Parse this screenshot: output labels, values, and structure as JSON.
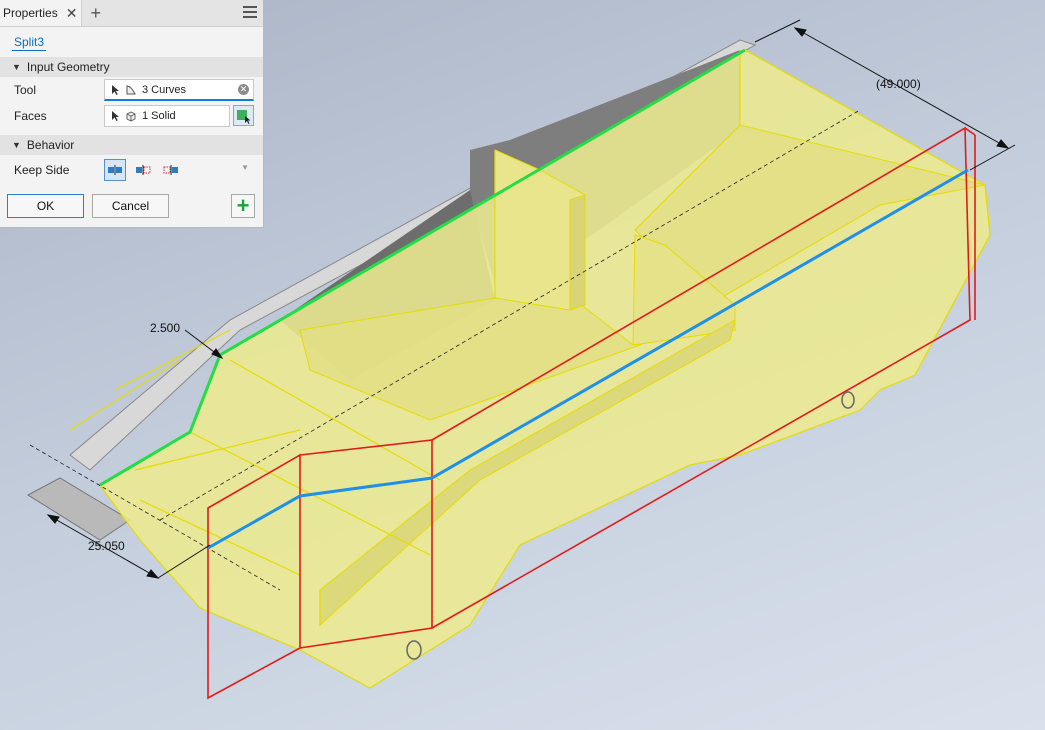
{
  "panel": {
    "tab_label": "Properties",
    "close_glyph": "✕",
    "add_glyph": "+",
    "feature_name": "Split3",
    "sections": {
      "input_geometry": "Input Geometry",
      "behavior": "Behavior"
    },
    "rows": {
      "tool_label": "Tool",
      "tool_value": "3 Curves",
      "faces_label": "Faces",
      "faces_value": "1 Solid",
      "keep_side_label": "Keep Side"
    },
    "keep_side_options": [
      "keep-both-icon",
      "keep-left-icon",
      "keep-right-icon"
    ],
    "keep_side_selected": 0,
    "buttons": {
      "ok": "OK",
      "cancel": "Cancel",
      "apply_glyph": "+"
    }
  },
  "viewport": {
    "dimensions": {
      "length": "(49.000)",
      "offset": "2.500",
      "width": "25.050"
    },
    "colors": {
      "body_fill": "#ece98f",
      "edge_highlight": "#e6dc00",
      "split_tool_green": "#22dd44",
      "split_tool_blue": "#1e90e8",
      "cut_plane_red": "#e31a1a",
      "background_top": "#aab4c6",
      "background_bottom": "#d9e1ec"
    }
  }
}
